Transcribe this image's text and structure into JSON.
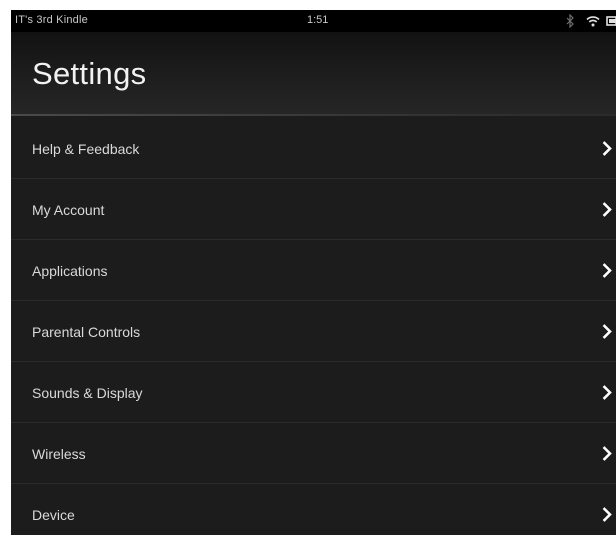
{
  "status_bar": {
    "device_name": "IT's 3rd Kindle",
    "time": "1:51",
    "icons": [
      "bluetooth-icon",
      "wifi-icon",
      "battery-icon"
    ]
  },
  "header": {
    "title": "Settings"
  },
  "menu": {
    "items": [
      {
        "label": "Help & Feedback",
        "icon": "chevron-right-icon"
      },
      {
        "label": "My Account",
        "icon": "chevron-right-icon"
      },
      {
        "label": "Applications",
        "icon": "chevron-right-icon"
      },
      {
        "label": "Parental Controls",
        "icon": "chevron-right-icon"
      },
      {
        "label": "Sounds & Display",
        "icon": "chevron-right-icon"
      },
      {
        "label": "Wireless",
        "icon": "chevron-right-icon"
      },
      {
        "label": "Device",
        "icon": "chevron-right-icon"
      }
    ]
  },
  "colors": {
    "background": "#1c1c1c",
    "status_bar": "#000000",
    "text_primary": "#f2f2f2",
    "text_secondary": "#d9d9d9",
    "divider": "#2b2b2b"
  }
}
